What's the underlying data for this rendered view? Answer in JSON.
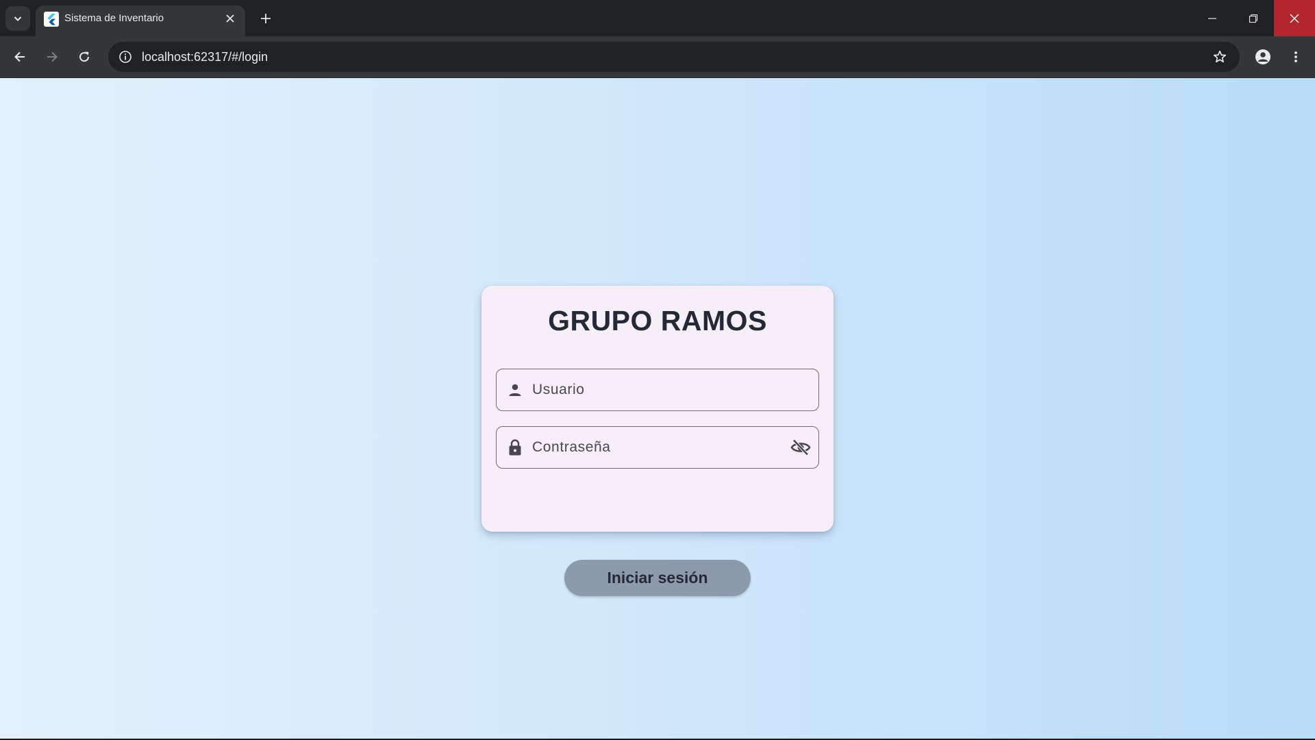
{
  "browser": {
    "tab": {
      "title": "Sistema de Inventario"
    },
    "address_bar": {
      "url": "localhost:62317/#/login"
    }
  },
  "login": {
    "title": "GRUPO RAMOS",
    "username": {
      "placeholder": "Usuario",
      "value": ""
    },
    "password": {
      "placeholder": "Contraseña",
      "value": ""
    },
    "submit_label": "Iniciar sesión"
  },
  "colors": {
    "card_background": "#f7eff7",
    "title_text": "#242938",
    "button_background": "#8d9aab",
    "page_gradient_start": "#e3f1fc",
    "page_gradient_end": "#b9dcf7"
  }
}
